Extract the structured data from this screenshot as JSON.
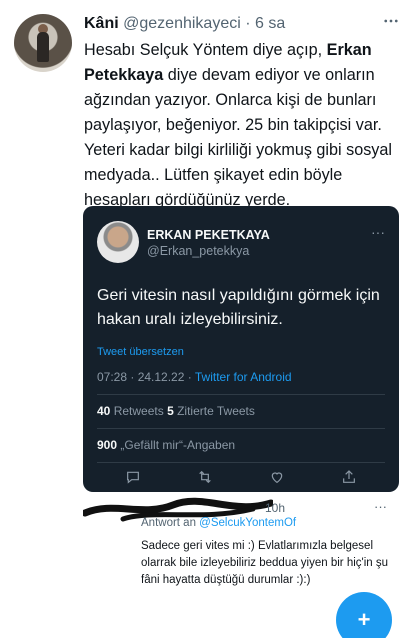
{
  "tweet": {
    "author_name": "Kâni",
    "author_handle": "@gezenhikayeci",
    "dot": "·",
    "time": "6 sa",
    "text_part1": "Hesabı Selçuk Yöntem diye açıp, ",
    "text_bold": "Erkan Petekkaya",
    "text_part2": " diye devam ediyor ve onların ağzından yazıyor. Onlarca kişi de bunları paylaşıyor, beğeniyor. 25 bin takipçisi var. Yeteri kadar bilgi kirliliği yokmuş gibi sosyal medyada.. Lütfen şikayet edin böyle hesapları gördüğünüz yerde.",
    "more_icon": "more-horizontal-icon"
  },
  "embedded": {
    "name": "ERKAN PEKETKAYA",
    "handle": "@Erkan_petekkya",
    "text": "Geri vitesin nasıl yapıldığını görmek için hakan uralı izleyebilirsiniz.",
    "translate": "Tweet übersetzen",
    "time": "07:28 · 24.12.22 · ",
    "source": "Twitter for Android",
    "retweets_count": "40",
    "retweets_label": " Retweets  ",
    "quotes_count": "5",
    "quotes_label": " Zitierte Tweets",
    "likes_count": "900",
    "likes_label": " „Gefällt mir“-Angaben",
    "more": "···",
    "bg_color": "#15202b"
  },
  "reply": {
    "time": "10h",
    "more": "···",
    "reply_to_prefix": "Antwort an ",
    "reply_to_handle": "@SelcukYontemOf",
    "text": "Sadece geri vites mi :) Evlatlarımızla belgesel olarrak bile izleyebiliriz beddua yiyen bir hiç'in şu fâni hayatta düştüğü durumlar :):)"
  },
  "fab": {
    "label": "+",
    "icon": "compose-feather-icon",
    "color": "#1d9bf0"
  }
}
